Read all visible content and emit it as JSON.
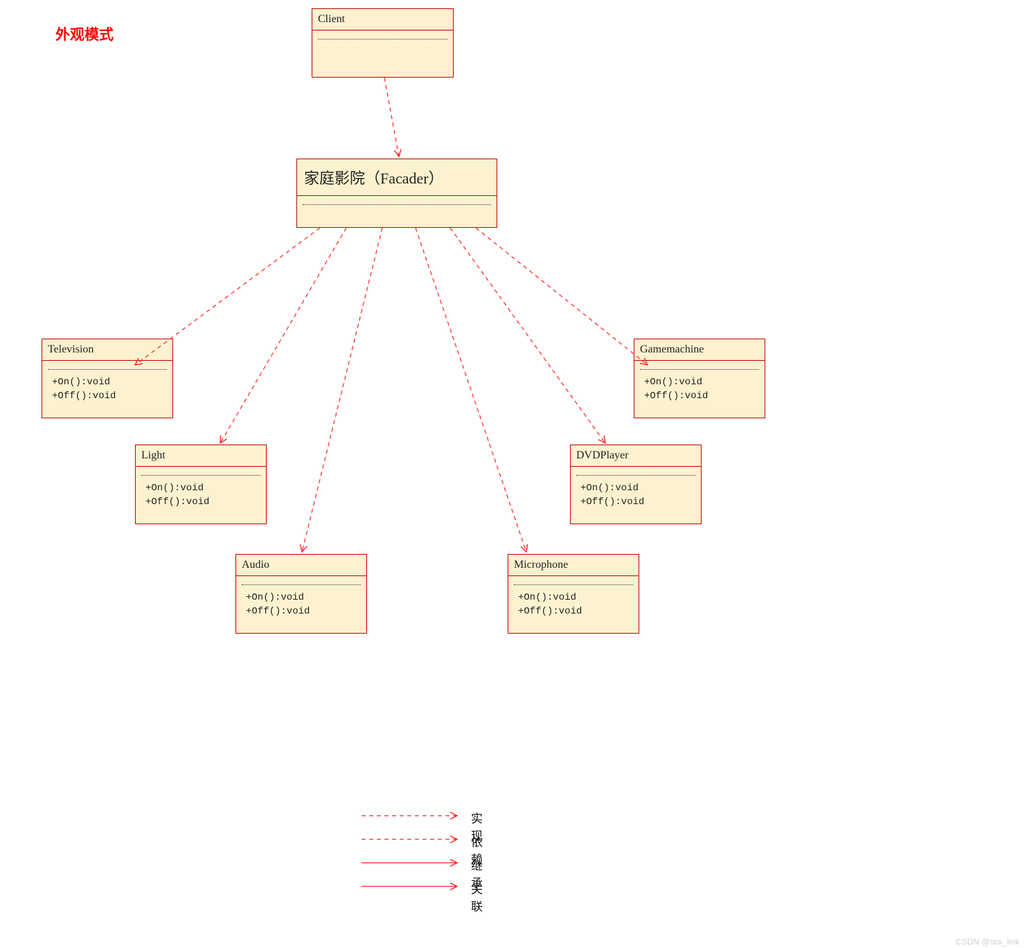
{
  "meta": {
    "title": "外观模式",
    "watermark": "CSDN @scx_link"
  },
  "colors": {
    "box_fill": "#fdf2d0",
    "box_border": "#c00000",
    "line": "#ff2020",
    "title_text": "#ff0000"
  },
  "classes": {
    "client": {
      "name": "Client",
      "ops": []
    },
    "facade": {
      "name": "家庭影院（Facader）",
      "ops": []
    },
    "television": {
      "name": "Television",
      "ops": [
        "+On():void",
        "+Off():void"
      ]
    },
    "gamemachine": {
      "name": "Gamemachine",
      "ops": [
        "+On():void",
        "+Off():void"
      ]
    },
    "light": {
      "name": "Light",
      "ops": [
        "+On():void",
        "+Off():void"
      ]
    },
    "dvdplayer": {
      "name": "DVDPlayer",
      "ops": [
        "+On():void",
        "+Off():void"
      ]
    },
    "audio": {
      "name": "Audio",
      "ops": [
        "+On():void",
        "+Off():void"
      ]
    },
    "microphone": {
      "name": "Microphone",
      "ops": [
        "+On():void",
        "+Off():void"
      ]
    }
  },
  "relations": [
    {
      "from": "client",
      "to": "facade",
      "type": "dependency"
    },
    {
      "from": "facade",
      "to": "television",
      "type": "dependency"
    },
    {
      "from": "facade",
      "to": "gamemachine",
      "type": "dependency"
    },
    {
      "from": "facade",
      "to": "light",
      "type": "dependency"
    },
    {
      "from": "facade",
      "to": "dvdplayer",
      "type": "dependency"
    },
    {
      "from": "facade",
      "to": "audio",
      "type": "dependency"
    },
    {
      "from": "facade",
      "to": "microphone",
      "type": "dependency"
    }
  ],
  "legend": [
    {
      "style": "dashed-open",
      "label": "实现"
    },
    {
      "style": "dashed-open",
      "label": "依赖"
    },
    {
      "style": "solid-open",
      "label": "继承"
    },
    {
      "style": "solid-open",
      "label": "关联"
    }
  ]
}
